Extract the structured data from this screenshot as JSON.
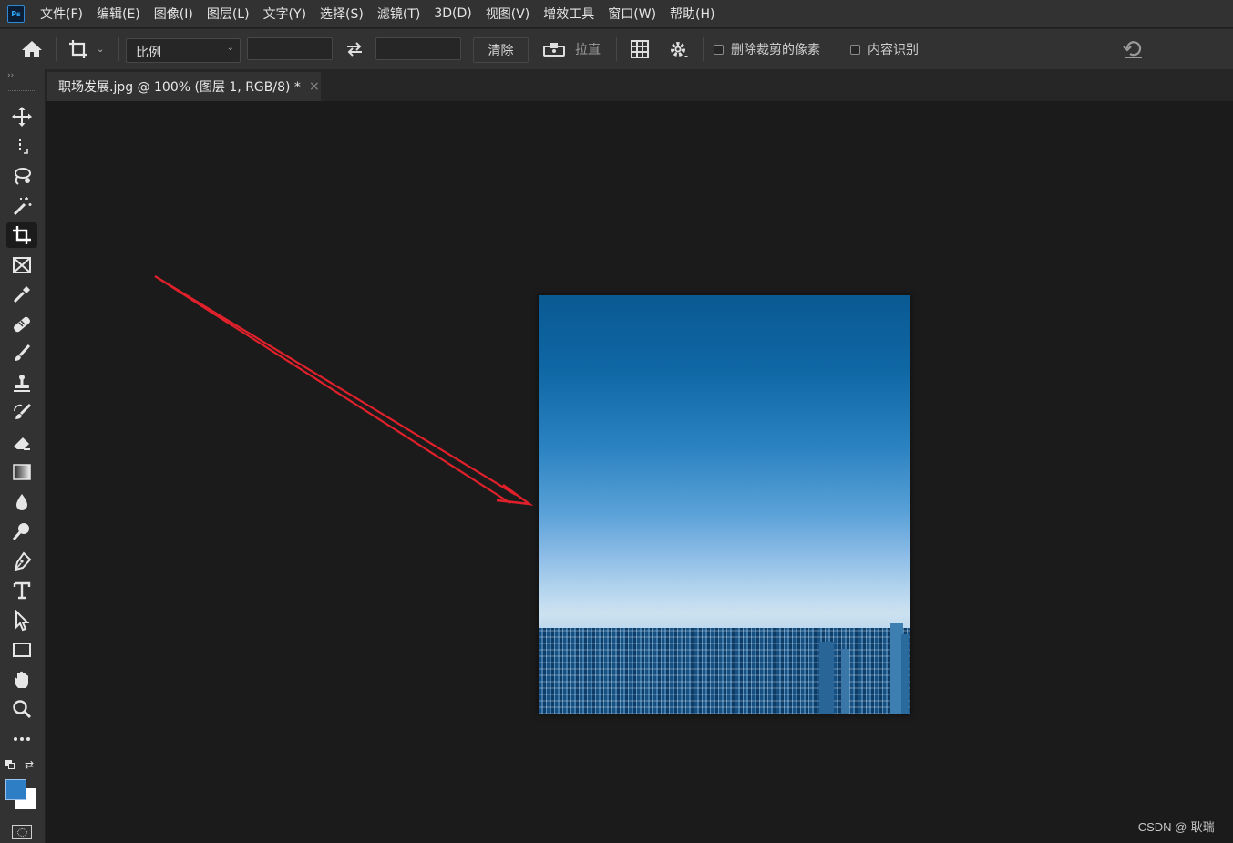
{
  "app": {
    "logo": "Ps"
  },
  "menu": [
    "文件(F)",
    "编辑(E)",
    "图像(I)",
    "图层(L)",
    "文字(Y)",
    "选择(S)",
    "滤镜(T)",
    "3D(D)",
    "视图(V)",
    "增效工具",
    "窗口(W)",
    "帮助(H)"
  ],
  "options": {
    "ratio_select": "比例",
    "width_value": "",
    "height_value": "",
    "clear_label": "清除",
    "straighten_label": "拉直",
    "delete_cropped_label": "删除裁剪的像素",
    "delete_cropped_checked": false,
    "content_aware_label": "内容识别",
    "content_aware_checked": false
  },
  "document": {
    "tab_title": "职场发展.jpg @ 100% (图层 1, RGB/8) *",
    "close_glyph": "×"
  },
  "colors": {
    "foreground": "#2e7ec6",
    "background": "#ffffff",
    "annotation_arrow": "#e0212b",
    "accent": "#31a8ff"
  },
  "tools": [
    "move-icon",
    "marquee-icon",
    "lasso-icon",
    "magic-wand-icon",
    "crop-icon",
    "frame-icon",
    "eyedropper-icon",
    "healing-brush-icon",
    "brush-icon",
    "stamp-icon",
    "history-brush-icon",
    "eraser-icon",
    "gradient-icon",
    "blur-icon",
    "dodge-icon",
    "pen-icon",
    "type-icon",
    "path-selection-icon",
    "rectangle-icon",
    "hand-icon",
    "zoom-icon",
    "more-icon"
  ],
  "active_tool": "crop-icon",
  "watermark": "CSDN @-耿瑞-"
}
